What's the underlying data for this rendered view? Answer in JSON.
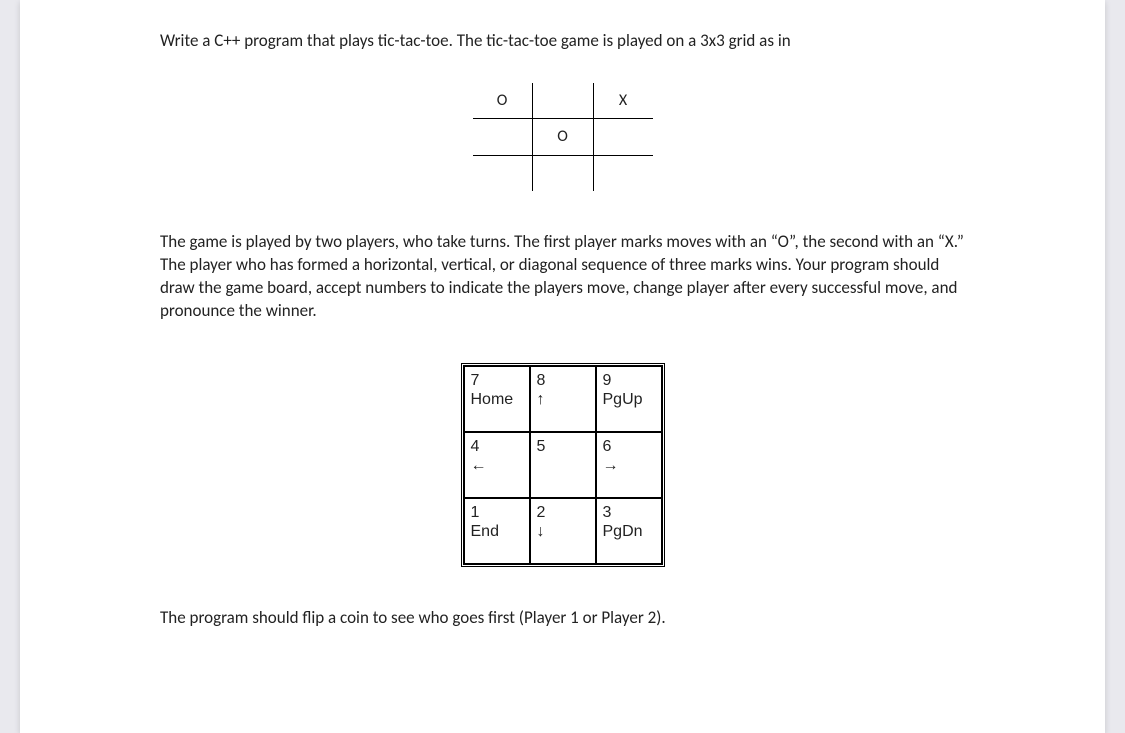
{
  "para1": "Write a C++ program that plays tic-tac-toe. The tic-tac-toe game is played on a 3x3 grid as in",
  "board": {
    "cells": [
      "O",
      "",
      "X",
      "",
      "O",
      "",
      "",
      "",
      ""
    ]
  },
  "para2": "The game is played by two players, who take turns. The first player marks moves with an “O”, the second with an “X.” The player who has formed a horizontal, vertical, or diagonal sequence of three marks wins. Your program should draw the game board, accept numbers to indicate the players move, change player after every successful move, and pronounce the winner.",
  "keypad": {
    "rows": [
      [
        {
          "num": "7",
          "label": "Home"
        },
        {
          "num": "8",
          "label": "↑"
        },
        {
          "num": "9",
          "label": "PgUp"
        }
      ],
      [
        {
          "num": "4",
          "label": "←"
        },
        {
          "num": "5",
          "label": ""
        },
        {
          "num": "6",
          "label": "→"
        }
      ],
      [
        {
          "num": "1",
          "label": "End"
        },
        {
          "num": "2",
          "label": "↓"
        },
        {
          "num": "3",
          "label": "PgDn"
        }
      ]
    ]
  },
  "para3": "The program should flip a coin to see who goes first (Player 1 or Player 2)."
}
